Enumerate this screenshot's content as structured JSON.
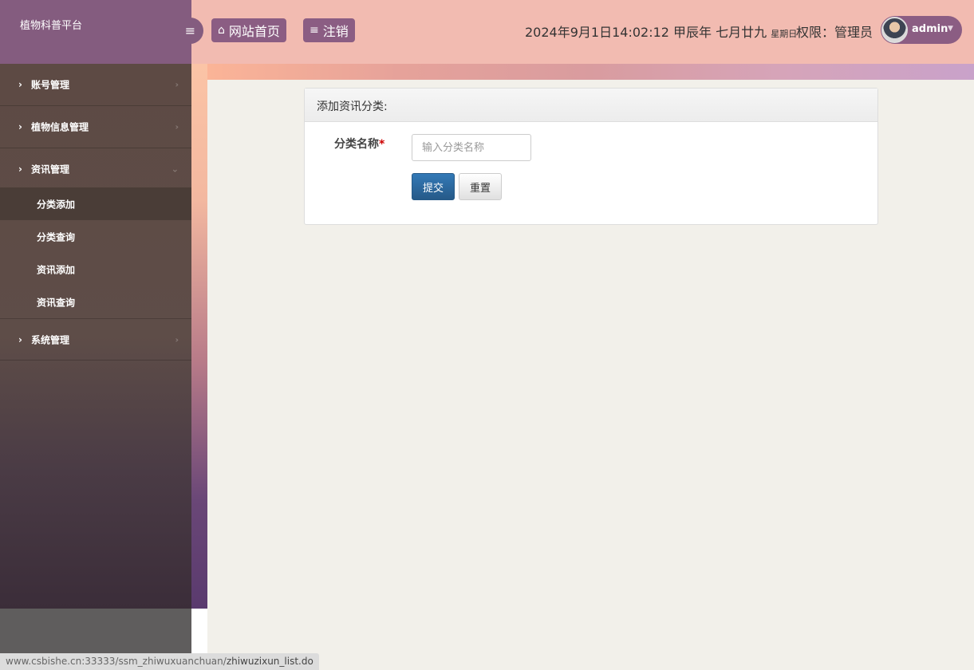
{
  "app": {
    "title": "植物科普平台"
  },
  "header": {
    "home_label": "网站首页",
    "logout_label": "注销",
    "datetime": "2024年9月1日14:02:12 甲辰年 七月廿九",
    "weekday": "星期日",
    "permission": "权限：管理员",
    "username": "admin"
  },
  "sidebar": {
    "groups": [
      {
        "label": "账号管理"
      },
      {
        "label": "植物信息管理"
      },
      {
        "label": "资讯管理",
        "expanded": true
      },
      {
        "label": "系统管理"
      }
    ],
    "sub_items": [
      {
        "label": "分类添加",
        "active": true
      },
      {
        "label": "分类查询"
      },
      {
        "label": "资讯添加"
      },
      {
        "label": "资讯查询"
      }
    ]
  },
  "panel": {
    "title": "添加资讯分类:",
    "field_label": "分类名称",
    "required_mark": "*",
    "input_placeholder": "输入分类名称",
    "input_value": "",
    "submit_label": "提交",
    "reset_label": "重置"
  },
  "status_bar": {
    "url_host": "www.csbishe.cn:33333/ssm_zhiwuxuanchuan/",
    "url_path": "zhiwuzixun_list.do"
  },
  "colors": {
    "sidebar_header": "#845c7f",
    "topbar": "#f2bbb1",
    "primary_button": "#337ab7"
  }
}
